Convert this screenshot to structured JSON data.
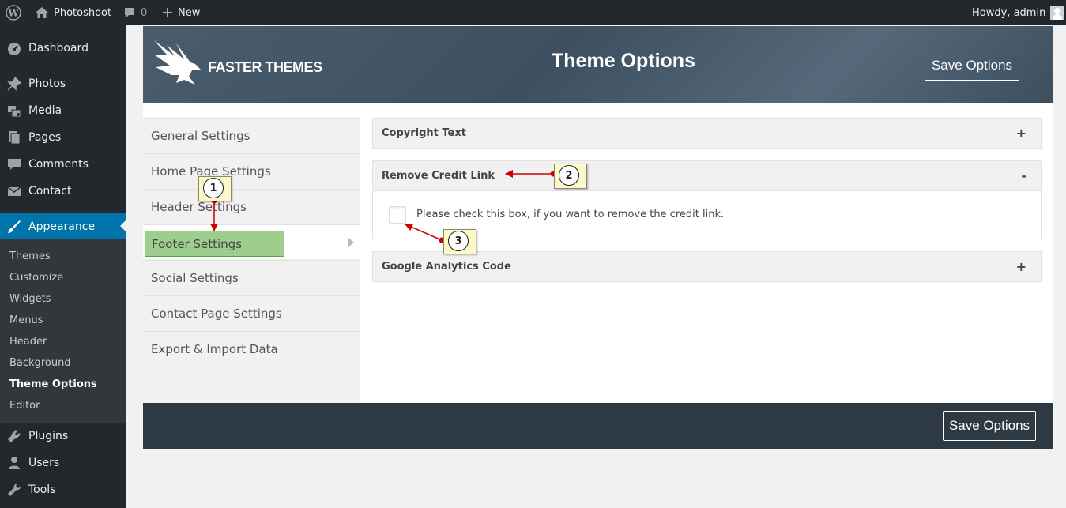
{
  "adminbar": {
    "site_name": "Photoshoot",
    "comments_count": "0",
    "new_label": "New",
    "howdy": "Howdy, admin"
  },
  "sidebar": {
    "items": [
      {
        "label": "Dashboard",
        "icon": "dashboard-icon"
      },
      {
        "label": "Photos",
        "icon": "pin-icon"
      },
      {
        "label": "Media",
        "icon": "media-icon"
      },
      {
        "label": "Pages",
        "icon": "pages-icon"
      },
      {
        "label": "Comments",
        "icon": "comments-icon"
      },
      {
        "label": "Contact",
        "icon": "mail-icon"
      },
      {
        "label": "Appearance",
        "icon": "brush-icon"
      },
      {
        "label": "Plugins",
        "icon": "plugin-icon"
      },
      {
        "label": "Users",
        "icon": "users-icon"
      },
      {
        "label": "Tools",
        "icon": "wrench-icon"
      }
    ],
    "submenu": [
      "Themes",
      "Customize",
      "Widgets",
      "Menus",
      "Header",
      "Background",
      "Theme Options",
      "Editor"
    ],
    "accent_color": "#0073aa"
  },
  "banner": {
    "logo_text": "FASTER THEMES",
    "title": "Theme Options",
    "save_label": "Save Options"
  },
  "nav": {
    "items": [
      "General Settings",
      "Home Page Settings",
      "Header Settings",
      "Footer Settings",
      "Social Settings",
      "Contact Page Settings",
      "Export & Import Data"
    ],
    "selected": "Footer Settings"
  },
  "sections": [
    {
      "title": "Copyright Text",
      "toggle": "+"
    },
    {
      "title": "Remove Credit Link",
      "toggle": "-",
      "checkbox_label": "Please check this box, if you want to remove the credit link."
    },
    {
      "title": "Google Analytics Code",
      "toggle": "+"
    }
  ],
  "footer": {
    "save_label": "Save Options"
  },
  "annotations": [
    "1",
    "2",
    "3"
  ]
}
